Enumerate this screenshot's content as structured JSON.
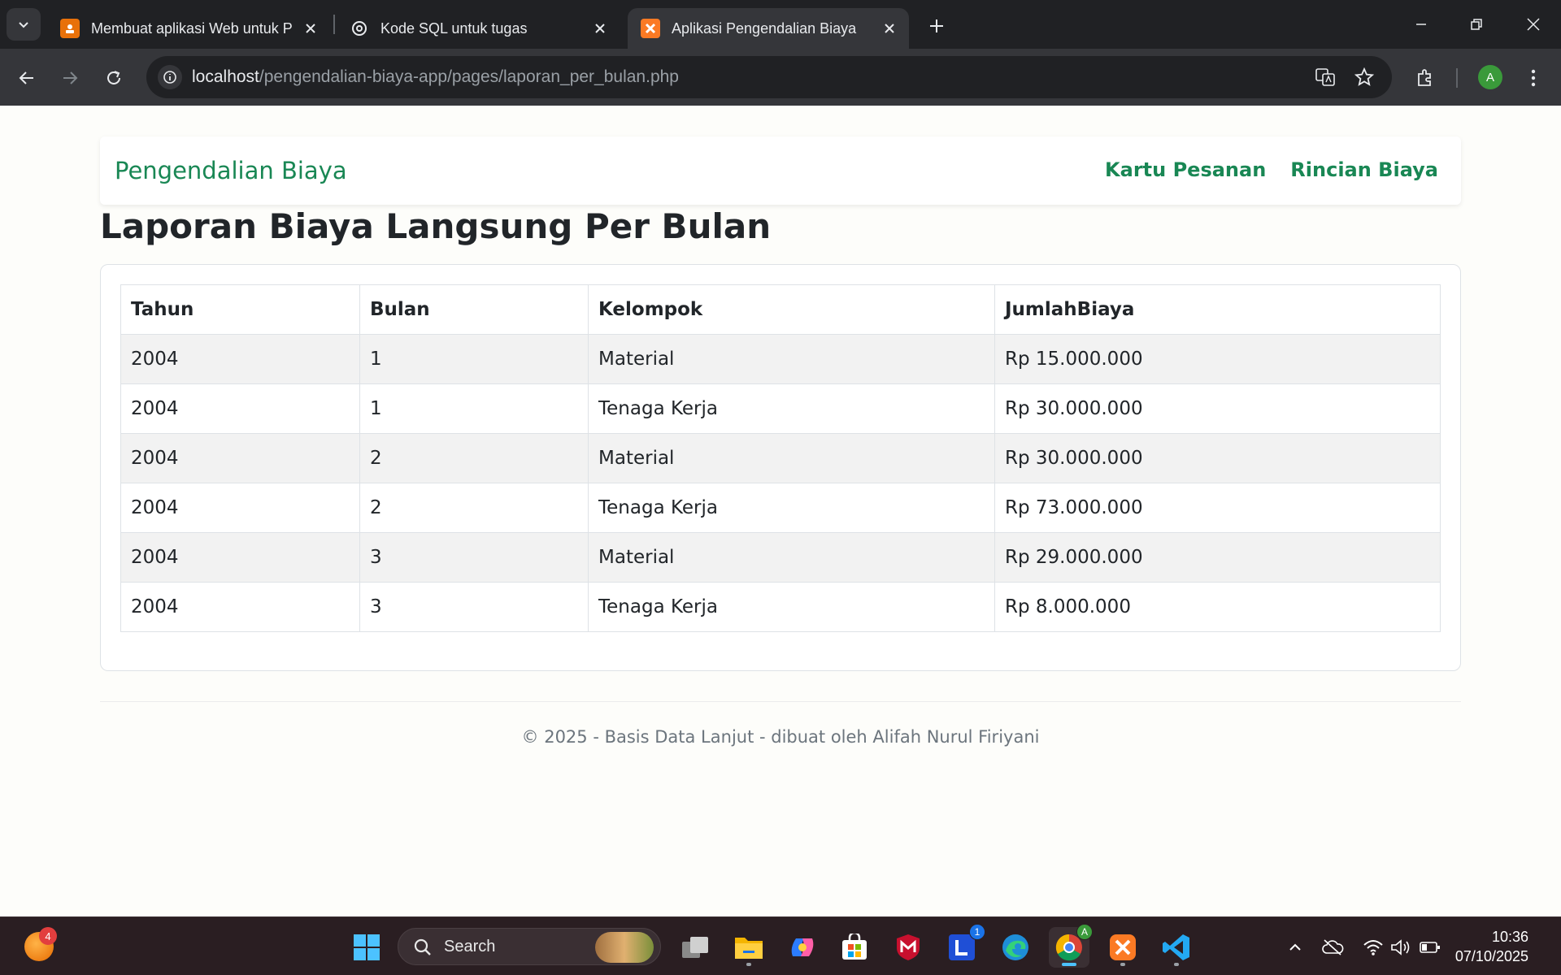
{
  "browser": {
    "tabs": [
      {
        "title": "Membuat aplikasi Web untuk P",
        "favicon": "presentation-icon",
        "active": false
      },
      {
        "title": "Kode SQL untuk tugas",
        "favicon": "chatgpt-icon",
        "active": false
      },
      {
        "title": "Aplikasi Pengendalian Biaya",
        "favicon": "xampp-icon",
        "active": true
      }
    ],
    "address": {
      "host": "localhost",
      "path": "/pengendalian-biaya-app/pages/laporan_per_bulan.php"
    },
    "profile_initial": "A"
  },
  "app": {
    "brand": "Pengendalian Biaya",
    "nav": [
      "Kartu Pesanan",
      "Rincian Biaya"
    ],
    "page_title": "Laporan Biaya Langsung Per Bulan",
    "table": {
      "headers": [
        "Tahun",
        "Bulan",
        "Kelompok",
        "JumlahBiaya"
      ],
      "rows": [
        [
          "2004",
          "1",
          "Material",
          "Rp 15.000.000"
        ],
        [
          "2004",
          "1",
          "Tenaga Kerja",
          "Rp 30.000.000"
        ],
        [
          "2004",
          "2",
          "Material",
          "Rp 30.000.000"
        ],
        [
          "2004",
          "2",
          "Tenaga Kerja",
          "Rp 73.000.000"
        ],
        [
          "2004",
          "3",
          "Material",
          "Rp 29.000.000"
        ],
        [
          "2004",
          "3",
          "Tenaga Kerja",
          "Rp 8.000.000"
        ]
      ]
    },
    "footer": "© 2025 - Basis Data Lanjut - dibuat oleh Alifah Nurul Firiyani"
  },
  "taskbar": {
    "widget_badge": "4",
    "search_label": "Search",
    "app_badge": "1",
    "chrome_badge": "A",
    "time": "10:36",
    "date": "07/10/2025"
  },
  "colors": {
    "accent": "#198754",
    "chrome_dark": "#202124",
    "chrome_mid": "#35363a",
    "stripe": "#f2f2f2"
  }
}
